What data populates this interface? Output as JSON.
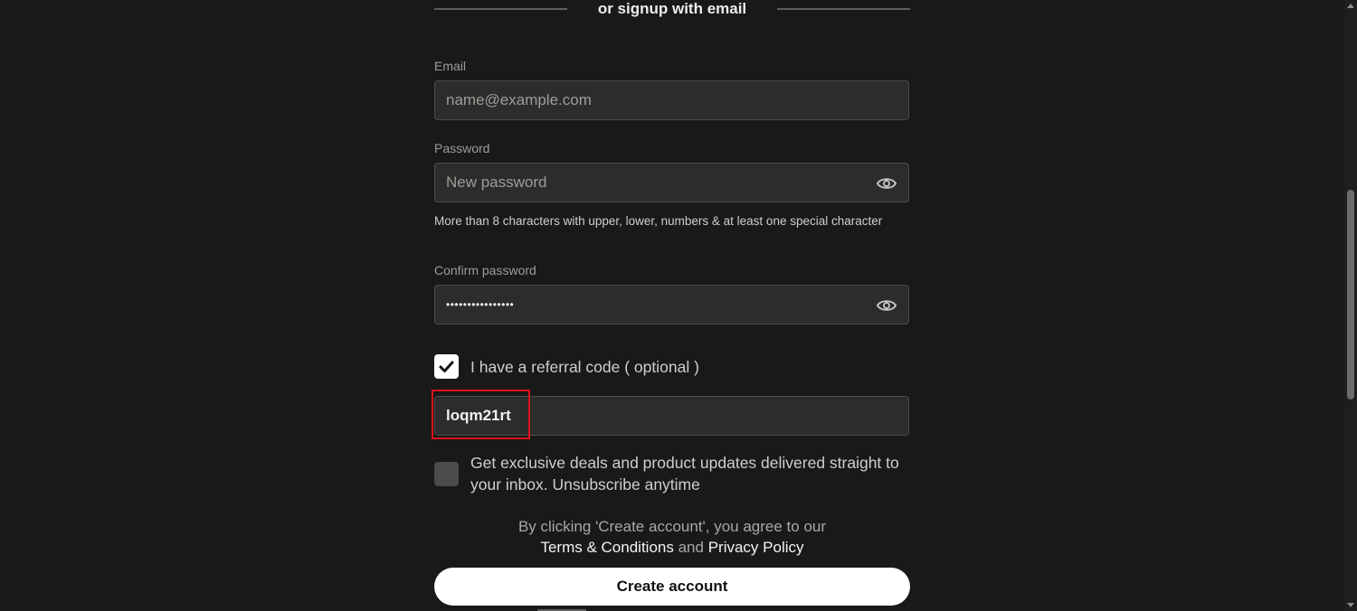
{
  "divider": {
    "text": "or signup with email"
  },
  "email": {
    "label": "Email",
    "placeholder": "name@example.com",
    "value": ""
  },
  "password": {
    "label": "Password",
    "placeholder": "New password",
    "value": "",
    "hint": "More than 8 characters with upper, lower, numbers & at least one special character"
  },
  "confirm_password": {
    "label": "Confirm password",
    "value": "••••••••••••••••"
  },
  "referral": {
    "checkbox_label": "I have a referral code ( optional )",
    "checked": true,
    "code": "loqm21rt"
  },
  "newsletter": {
    "text": "Get exclusive deals and product updates delivered straight to your inbox. Unsubscribe anytime",
    "checked": false
  },
  "terms": {
    "prefix": "By clicking 'Create account', you agree to our",
    "terms_link": "Terms & Conditions",
    "and": "and",
    "privacy_link": "Privacy Policy"
  },
  "create_button": "Create account",
  "icons": {
    "eye": "eye-icon",
    "check": "check-icon"
  },
  "colors": {
    "highlight": "#e0101b",
    "background": "#181918",
    "field": "#2a2d2a"
  }
}
